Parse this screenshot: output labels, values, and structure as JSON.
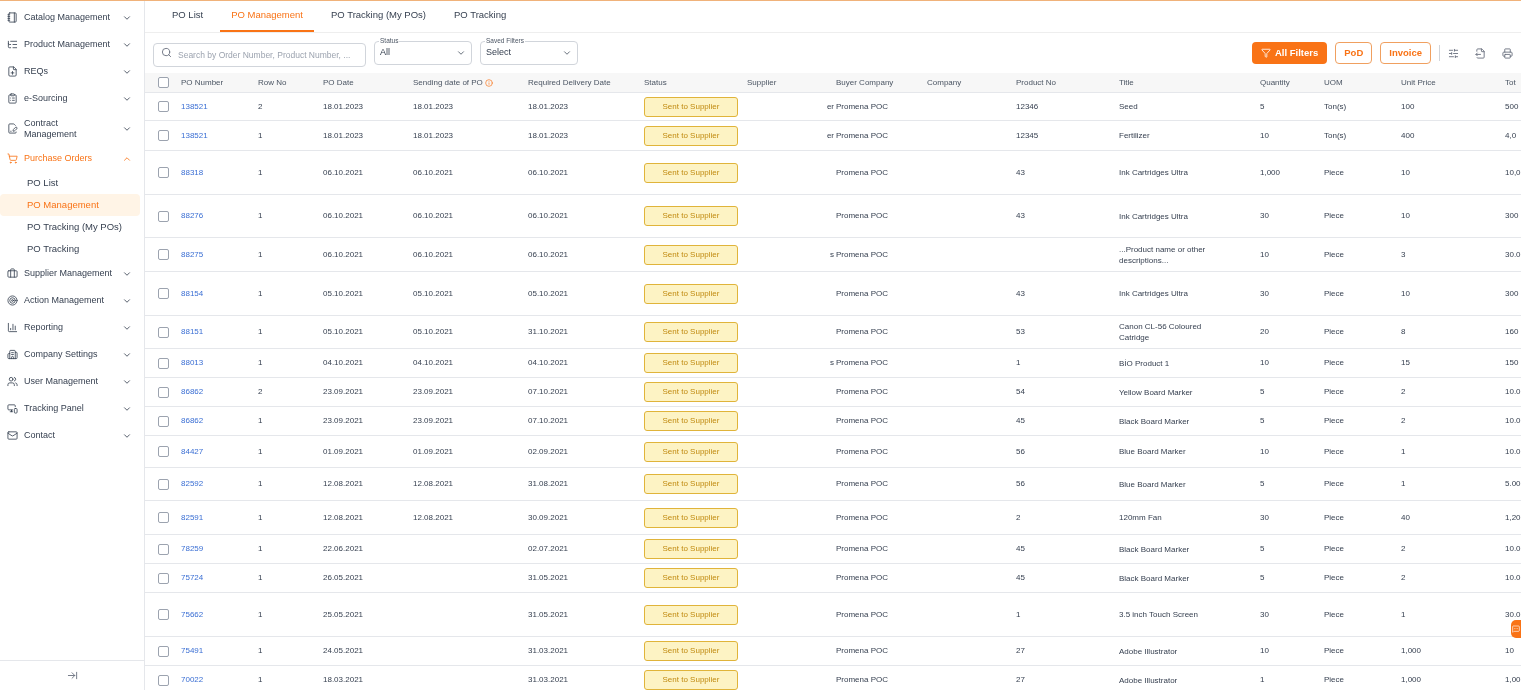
{
  "sidebar": {
    "items": [
      {
        "label": "Catalog Management",
        "expanded": false,
        "active": false
      },
      {
        "label": "Product Management",
        "expanded": false,
        "active": false
      },
      {
        "label": "REQs",
        "expanded": false,
        "active": false
      },
      {
        "label": "e-Sourcing",
        "expanded": false,
        "active": false
      },
      {
        "label": "Contract Management",
        "expanded": false,
        "active": false
      },
      {
        "label": "Purchase Orders",
        "expanded": true,
        "active": true,
        "children": [
          {
            "label": "PO List",
            "selected": false
          },
          {
            "label": "PO Management",
            "selected": true
          },
          {
            "label": "PO Tracking (My POs)",
            "selected": false
          },
          {
            "label": "PO Tracking",
            "selected": false
          }
        ]
      },
      {
        "label": "Supplier Management",
        "expanded": false,
        "active": false
      },
      {
        "label": "Action Management",
        "expanded": false,
        "active": false
      },
      {
        "label": "Reporting",
        "expanded": false,
        "active": false
      },
      {
        "label": "Company Settings",
        "expanded": false,
        "active": false
      },
      {
        "label": "User Management",
        "expanded": false,
        "active": false
      },
      {
        "label": "Tracking Panel",
        "expanded": false,
        "active": false
      },
      {
        "label": "Contact",
        "expanded": false,
        "active": false
      }
    ]
  },
  "tabs": [
    {
      "label": "PO List",
      "selected": false
    },
    {
      "label": "PO Management",
      "selected": true
    },
    {
      "label": "PO Tracking (My POs)",
      "selected": false
    },
    {
      "label": "PO Tracking",
      "selected": false
    }
  ],
  "search": {
    "placeholder": "Search by Order Number, Product Number, ..."
  },
  "filters": [
    {
      "label": "Status",
      "value": "All"
    },
    {
      "label": "Saved Filters",
      "value": "Select"
    }
  ],
  "buttons": [
    {
      "label": "All Filters",
      "kind": "primary"
    },
    {
      "label": "PoD",
      "kind": "outline"
    },
    {
      "label": "Invoice",
      "kind": "outline"
    }
  ],
  "table": {
    "select_all_checked": false,
    "columns": [
      {
        "label": "PO Number",
        "info": false
      },
      {
        "label": "Row No",
        "info": false
      },
      {
        "label": "PO Date",
        "info": false
      },
      {
        "label": "Sending date of PO",
        "info": true
      },
      {
        "label": "Required Delivery Date",
        "info": false
      },
      {
        "label": "Status",
        "info": false
      },
      {
        "label": "Supplier",
        "info": false
      },
      {
        "label": "Buyer Company",
        "info": false
      },
      {
        "label": "Company",
        "info": false
      },
      {
        "label": "Product No",
        "info": false
      },
      {
        "label": "Title",
        "info": false
      },
      {
        "label": "Quantity",
        "info": false
      },
      {
        "label": "UOM",
        "info": false
      },
      {
        "label": "Unit Price",
        "info": false
      },
      {
        "label": "Tot",
        "info": false
      }
    ],
    "rows": [
      {
        "checked": false,
        "po_number": "138521",
        "row_no": "2",
        "po_date": "18.01.2023",
        "sending_date": "18.01.2023",
        "required_date": "18.01.2023",
        "status": "Sent to Supplier",
        "supplier": "er",
        "buyer": "Promena POC",
        "product_no": "12346",
        "title": "Seed",
        "quantity": "5",
        "uom": "Ton(s)",
        "unit_price": "100",
        "total": "500"
      },
      {
        "checked": false,
        "po_number": "138521",
        "row_no": "1",
        "po_date": "18.01.2023",
        "sending_date": "18.01.2023",
        "required_date": "18.01.2023",
        "status": "Sent to Supplier",
        "supplier": "er",
        "buyer": "Promena POC",
        "product_no": "12345",
        "title": "Fertilizer",
        "quantity": "10",
        "uom": "Ton(s)",
        "unit_price": "400",
        "total": "4,0"
      },
      {
        "checked": false,
        "po_number": "88318",
        "row_no": "1",
        "po_date": "06.10.2021",
        "sending_date": "06.10.2021",
        "required_date": "06.10.2021",
        "status": "Sent to Supplier",
        "buyer": "Promena POC",
        "product_no": "43",
        "title": "Ink Cartridges Ultra",
        "quantity": "1,000",
        "uom": "Piece",
        "unit_price": "10",
        "total": "10,0"
      },
      {
        "checked": false,
        "po_number": "88276",
        "row_no": "1",
        "po_date": "06.10.2021",
        "sending_date": "06.10.2021",
        "required_date": "06.10.2021",
        "status": "Sent to Supplier",
        "buyer": "Promena POC",
        "product_no": "43",
        "title": "Ink Cartridges Ultra",
        "quantity": "30",
        "uom": "Piece",
        "unit_price": "10",
        "total": "300"
      },
      {
        "checked": false,
        "po_number": "88275",
        "row_no": "1",
        "po_date": "06.10.2021",
        "sending_date": "06.10.2021",
        "required_date": "06.10.2021",
        "status": "Sent to Supplier",
        "supplier": "s",
        "buyer": "Promena POC",
        "title": "...Product name or other descriptions...",
        "quantity": "10",
        "uom": "Piece",
        "unit_price": "3",
        "total": "30.0"
      },
      {
        "checked": false,
        "po_number": "88154",
        "row_no": "1",
        "po_date": "05.10.2021",
        "sending_date": "05.10.2021",
        "required_date": "05.10.2021",
        "status": "Sent to Supplier",
        "buyer": "Promena POC",
        "product_no": "43",
        "title": "Ink Cartridges Ultra",
        "quantity": "30",
        "uom": "Piece",
        "unit_price": "10",
        "total": "300"
      },
      {
        "checked": false,
        "po_number": "88151",
        "row_no": "1",
        "po_date": "05.10.2021",
        "sending_date": "05.10.2021",
        "required_date": "31.10.2021",
        "status": "Sent to Supplier",
        "buyer": "Promena POC",
        "product_no": "53",
        "title": "Canon CL-56 Coloured Catridge",
        "quantity": "20",
        "uom": "Piece",
        "unit_price": "8",
        "total": "160"
      },
      {
        "checked": false,
        "po_number": "88013",
        "row_no": "1",
        "po_date": "04.10.2021",
        "sending_date": "04.10.2021",
        "required_date": "04.10.2021",
        "status": "Sent to Supplier",
        "supplier": "s",
        "buyer": "Promena POC",
        "product_no": "1",
        "title": "BİO Product 1",
        "quantity": "10",
        "uom": "Piece",
        "unit_price": "15",
        "total": "150"
      },
      {
        "checked": false,
        "po_number": "86862",
        "row_no": "2",
        "po_date": "23.09.2021",
        "sending_date": "23.09.2021",
        "required_date": "07.10.2021",
        "status": "Sent to Supplier",
        "buyer": "Promena POC",
        "product_no": "54",
        "title": "Yellow Board Marker",
        "quantity": "5",
        "uom": "Piece",
        "unit_price": "2",
        "total": "10.0"
      },
      {
        "checked": false,
        "po_number": "86862",
        "row_no": "1",
        "po_date": "23.09.2021",
        "sending_date": "23.09.2021",
        "required_date": "07.10.2021",
        "status": "Sent to Supplier",
        "buyer": "Promena POC",
        "product_no": "45",
        "title": "Black Board Marker",
        "quantity": "5",
        "uom": "Piece",
        "unit_price": "2",
        "total": "10.0"
      },
      {
        "checked": false,
        "po_number": "84427",
        "row_no": "1",
        "po_date": "01.09.2021",
        "sending_date": "01.09.2021",
        "required_date": "02.09.2021",
        "status": "Sent to Supplier",
        "buyer": "Promena POC",
        "product_no": "56",
        "title": "Blue Board Marker",
        "quantity": "10",
        "uom": "Piece",
        "unit_price": "1",
        "total": "10.0"
      },
      {
        "checked": false,
        "po_number": "82592",
        "row_no": "1",
        "po_date": "12.08.2021",
        "sending_date": "12.08.2021",
        "required_date": "31.08.2021",
        "status": "Sent to Supplier",
        "buyer": "Promena POC",
        "product_no": "56",
        "title": "Blue Board Marker",
        "quantity": "5",
        "uom": "Piece",
        "unit_price": "1",
        "total": "5.00"
      },
      {
        "checked": false,
        "po_number": "82591",
        "row_no": "1",
        "po_date": "12.08.2021",
        "sending_date": "12.08.2021",
        "required_date": "30.09.2021",
        "status": "Sent to Supplier",
        "buyer": "Promena POC",
        "product_no": "2",
        "title": "120mm Fan",
        "quantity": "30",
        "uom": "Piece",
        "unit_price": "40",
        "total": "1,20"
      },
      {
        "checked": false,
        "po_number": "78259",
        "row_no": "1",
        "po_date": "22.06.2021",
        "required_date": "02.07.2021",
        "status": "Sent to Supplier",
        "buyer": "Promena POC",
        "product_no": "45",
        "title": "Black Board Marker",
        "quantity": "5",
        "uom": "Piece",
        "unit_price": "2",
        "total": "10.0"
      },
      {
        "checked": false,
        "po_number": "75724",
        "row_no": "1",
        "po_date": "26.05.2021",
        "required_date": "31.05.2021",
        "status": "Sent to Supplier",
        "buyer": "Promena POC",
        "product_no": "45",
        "title": "Black Board Marker",
        "quantity": "5",
        "uom": "Piece",
        "unit_price": "2",
        "total": "10.0"
      },
      {
        "checked": false,
        "po_number": "75662",
        "row_no": "1",
        "po_date": "25.05.2021",
        "required_date": "31.05.2021",
        "status": "Sent to Supplier",
        "buyer": "Promena POC",
        "product_no": "1",
        "title": "3.5 inch Touch Screen",
        "quantity": "30",
        "uom": "Piece",
        "unit_price": "1",
        "total": "30.0"
      },
      {
        "checked": false,
        "po_number": "75491",
        "row_no": "1",
        "po_date": "24.05.2021",
        "required_date": "31.03.2021",
        "status": "Sent to Supplier",
        "buyer": "Promena POC",
        "product_no": "27",
        "title": "Adobe Illustrator",
        "quantity": "10",
        "uom": "Piece",
        "unit_price": "1,000",
        "total": "10"
      },
      {
        "checked": false,
        "po_number": "70022",
        "row_no": "1",
        "po_date": "18.03.2021",
        "required_date": "31.03.2021",
        "status": "Sent to Supplier",
        "buyer": "Promena POC",
        "product_no": "27",
        "title": "Adobe Illustrator",
        "quantity": "1",
        "uom": "Piece",
        "unit_price": "1,000",
        "total": "1,00"
      }
    ]
  }
}
